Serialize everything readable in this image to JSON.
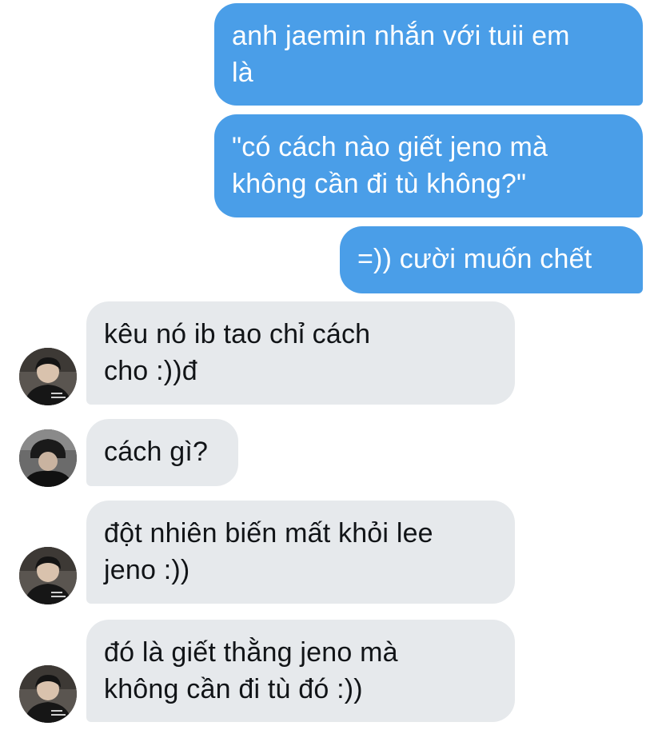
{
  "conversation": {
    "messages": [
      {
        "sender": "me",
        "text": "anh jaemin nhắn với tuii em\nlà"
      },
      {
        "sender": "me",
        "text": "\"có cách nào giết jeno mà\nkhông cần đi tù không?\""
      },
      {
        "sender": "me",
        "text": "=)) cười muốn chết"
      },
      {
        "sender": "other",
        "text": "kêu nó ib tao chỉ cách\ncho :))đ"
      },
      {
        "sender": "other",
        "text": "cách gì?"
      },
      {
        "sender": "other",
        "text": "đột nhiên biến mất khỏi lee\njeno :))"
      },
      {
        "sender": "other",
        "text": "đó là giết thằng jeno mà\nkhông cần đi tù đó :))"
      }
    ]
  },
  "colors": {
    "sent_bubble": "#4a9ee8",
    "received_bubble": "#e6e9ec",
    "sent_text": "#ffffff",
    "received_text": "#111417"
  }
}
